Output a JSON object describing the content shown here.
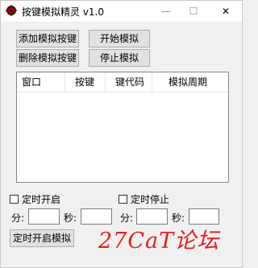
{
  "window": {
    "title": "按键模拟精灵 v1.0",
    "minimize_glyph": "—",
    "maximize_glyph": "☐",
    "close_glyph": "✕"
  },
  "buttons": {
    "add_key": "添加模拟按键",
    "start": "开始模拟",
    "delete_key": "删除模拟按键",
    "stop": "停止模拟",
    "timed_start": "定时开启模拟"
  },
  "list": {
    "columns": [
      "窗口",
      "按键",
      "键代码",
      "模拟周期"
    ]
  },
  "timer": {
    "start_label": "定时开启",
    "stop_label": "定时停止",
    "minute_label": "分:",
    "second_label": "秒:"
  },
  "watermark": "27CaT论坛",
  "colors": {
    "watermark": "#e41e1e",
    "icon": "#b00000"
  },
  "icons": {
    "app": "gear-icon"
  }
}
